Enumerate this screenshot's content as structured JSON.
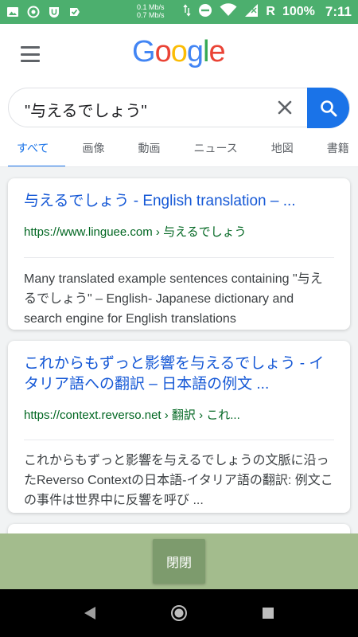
{
  "status_bar": {
    "net_speed_up": "0.1 Mb/s",
    "net_speed_down": "0.7 Mb/s",
    "roaming": "R",
    "battery_pct": "100%",
    "time": "7:11"
  },
  "header": {
    "logo_letters": [
      "G",
      "o",
      "o",
      "g",
      "l",
      "e"
    ],
    "logo_colors": [
      "#4285f4",
      "#ea4335",
      "#fbbc05",
      "#4285f4",
      "#34a853",
      "#ea4335"
    ]
  },
  "search": {
    "query": "\"与えるでしょう\"",
    "clear_icon": "close-icon",
    "search_icon": "search-icon"
  },
  "tabs": [
    {
      "label": "すべて",
      "active": true
    },
    {
      "label": "画像",
      "active": false
    },
    {
      "label": "動画",
      "active": false
    },
    {
      "label": "ニュース",
      "active": false
    },
    {
      "label": "地図",
      "active": false
    },
    {
      "label": "書籍",
      "active": false
    }
  ],
  "results": [
    {
      "title": "与えるでしょう - English translation – ...",
      "url": "https://www.linguee.com › 与えるでしょう",
      "snippet": "Many translated example sentences containing \"与えるでしょう\" – English- Japanese dictionary and search engine for English translations"
    },
    {
      "title": "これからもずっと影響を与えるでしょう - イタリア語への翻訳 – 日本語の例文 ...",
      "url": "https://context.reverso.net › 翻訳 › これ...",
      "snippet": "これからもずっと影響を与えるでしょうの文脈に沿ったReverso Contextの日本語-イタリア語の翻訳: 例文この事件は世界中に反響を呼び ..."
    }
  ],
  "close_button": {
    "label": "閉閉"
  },
  "colors": {
    "status_bar": "#4caf6e",
    "accent": "#1a73e8",
    "close_area": "#a3bc8d",
    "close_button": "#7d9b6d"
  }
}
